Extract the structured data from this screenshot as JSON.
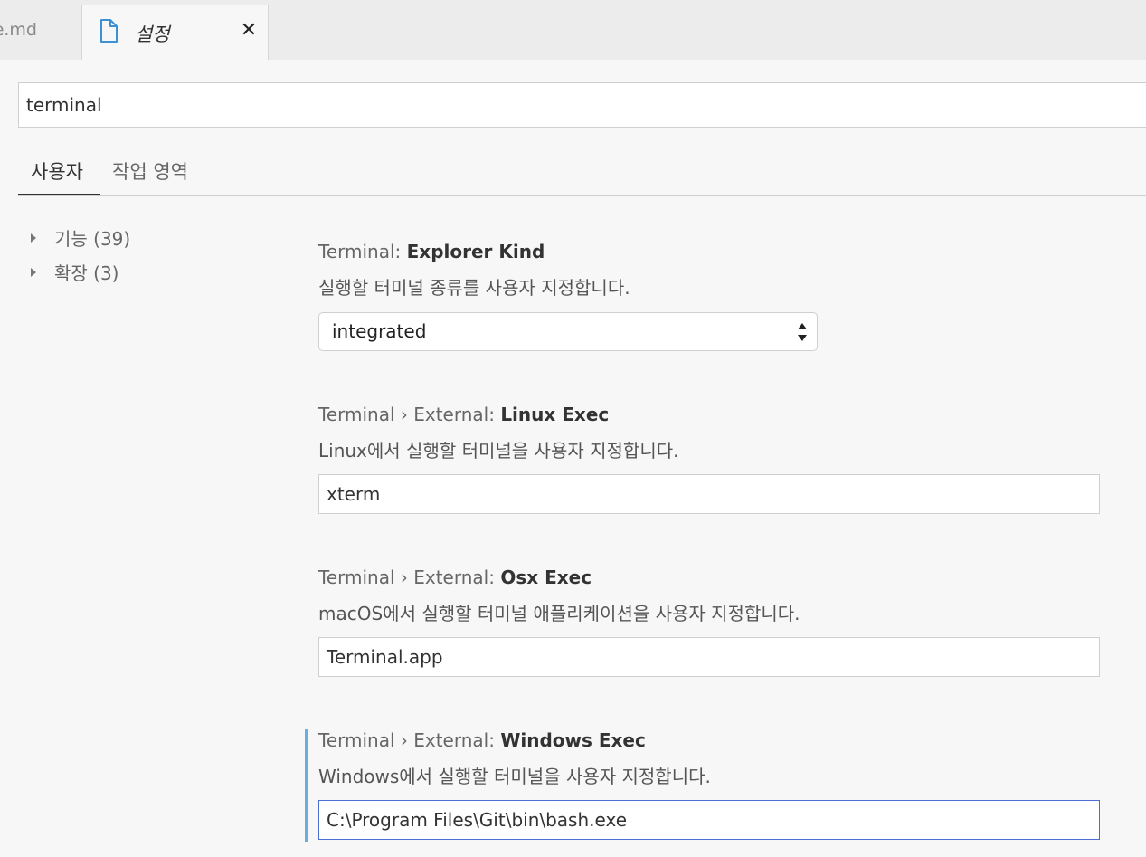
{
  "tabs": {
    "previous_label": "e.md",
    "active_label": "설정",
    "close_glyph": "✕"
  },
  "search": {
    "value": "terminal"
  },
  "scope": {
    "user": "사용자",
    "workspace": "작업 영역"
  },
  "toc": [
    {
      "label": "기능 (39)"
    },
    {
      "label": "확장 (3)"
    }
  ],
  "settings": [
    {
      "category": "Terminal: ",
      "name": "Explorer Kind",
      "description": "실행할 터미널 종류를 사용자 지정합니다.",
      "control": "select",
      "value": "integrated"
    },
    {
      "category": "Terminal › External: ",
      "name": "Linux Exec",
      "description": "Linux에서 실행할 터미널을 사용자 지정합니다.",
      "control": "text",
      "value": "xterm"
    },
    {
      "category": "Terminal › External: ",
      "name": "Osx Exec",
      "description": "macOS에서 실행할 터미널 애플리케이션을 사용자 지정합니다.",
      "control": "text",
      "value": "Terminal.app"
    },
    {
      "category": "Terminal › External: ",
      "name": "Windows Exec",
      "description": "Windows에서 실행할 터미널을 사용자 지정합니다.",
      "control": "text",
      "value": "C:\\Program Files\\Git\\bin\\bash.exe"
    }
  ],
  "colors": {
    "accent_focus": "#4a6fd1",
    "focus_bar": "#6aaedf",
    "file_icon": "#3d8fd6"
  }
}
